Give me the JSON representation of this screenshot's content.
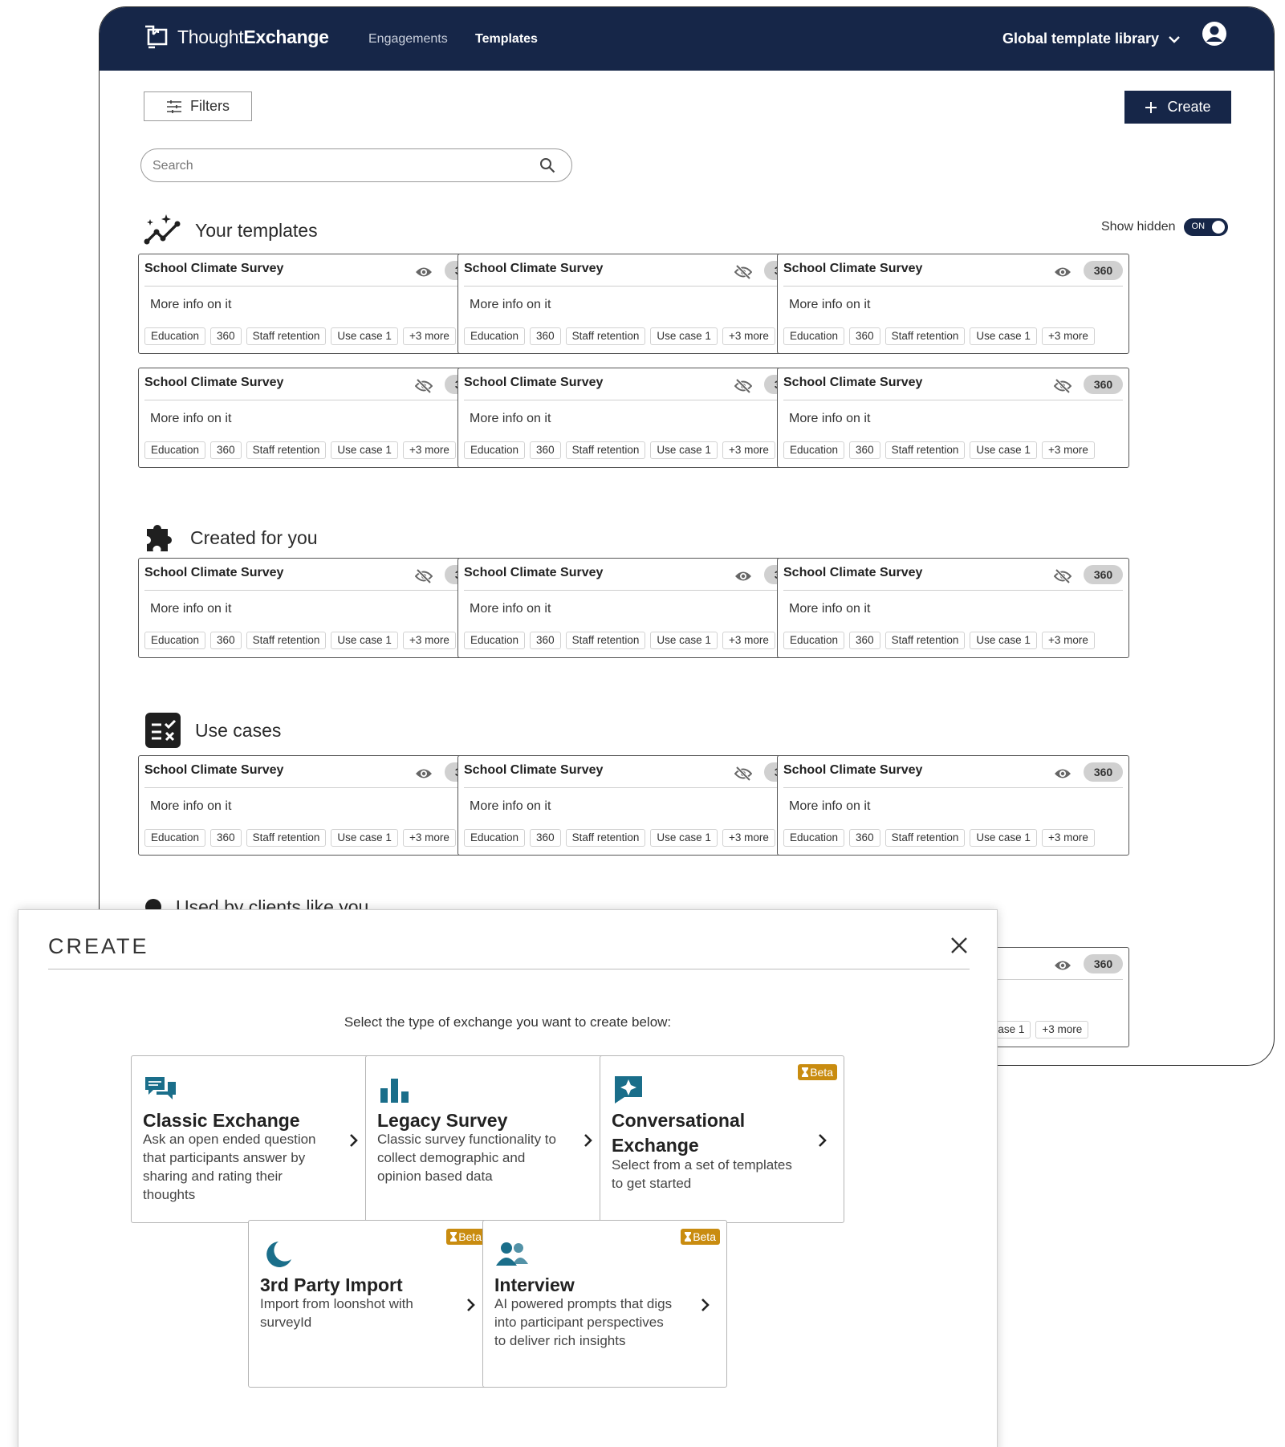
{
  "header": {
    "brand_light": "Thought",
    "brand_bold": "Exchange",
    "nav": [
      "Engagements",
      "Templates"
    ],
    "library": "Global template library"
  },
  "toolbar": {
    "filters_label": "Filters",
    "create_label": "Create",
    "search_placeholder": "Search",
    "show_hidden_label": "Show hidden",
    "toggle_label": "ON"
  },
  "sections": {
    "your_templates": "Your templates",
    "created_for_you": "Created for you",
    "use_cases": "Use cases",
    "used_by_clients": "Used by clients like you"
  },
  "card": {
    "title": "School Climate Survey",
    "badge": "360",
    "description": "More info on it",
    "tags": [
      "Education",
      "360",
      "Staff retention",
      "Use case 1",
      "+3 more"
    ],
    "partial_title": "rvey",
    "partial_tags": [
      "Staff retention",
      "Use case 1",
      "+3 more"
    ]
  },
  "card_visibility": {
    "your_templates": [
      "visible",
      "hidden",
      "visible",
      "hidden",
      "hidden",
      "hidden"
    ],
    "created_for_you": [
      "hidden",
      "visible",
      "hidden"
    ],
    "use_cases": [
      "visible",
      "hidden",
      "visible"
    ],
    "used_by_clients": [
      "visible"
    ]
  },
  "modal": {
    "title": "CREATE",
    "prompt": "Select the type of exchange you want to create below:",
    "beta_label": "Beta",
    "options": [
      {
        "title": "Classic Exchange",
        "description": "Ask an open ended question that participants answer by sharing and rating their thoughts",
        "icon": "chat-bubbles-icon",
        "beta": false
      },
      {
        "title": "Legacy Survey",
        "description": "Classic survey functionality to collect demographic and opinion based data",
        "icon": "bar-chart-icon",
        "beta": false
      },
      {
        "title": "Conversational Exchange",
        "description": "Select from a set of templates to get started",
        "icon": "sparkle-chat-icon",
        "beta": true
      },
      {
        "title": "3rd Party Import",
        "description": "Import from loonshot with surveyId",
        "icon": "crescent-moon-icon",
        "beta": true
      },
      {
        "title": "Interview",
        "description": "AI powered prompts that digs into participant perspectives to deliver rich insights",
        "icon": "people-icon",
        "beta": true
      }
    ]
  },
  "colors": {
    "navy": "#162648",
    "accent_teal": "#1a6e8a",
    "beta_gold": "#c98c10"
  }
}
